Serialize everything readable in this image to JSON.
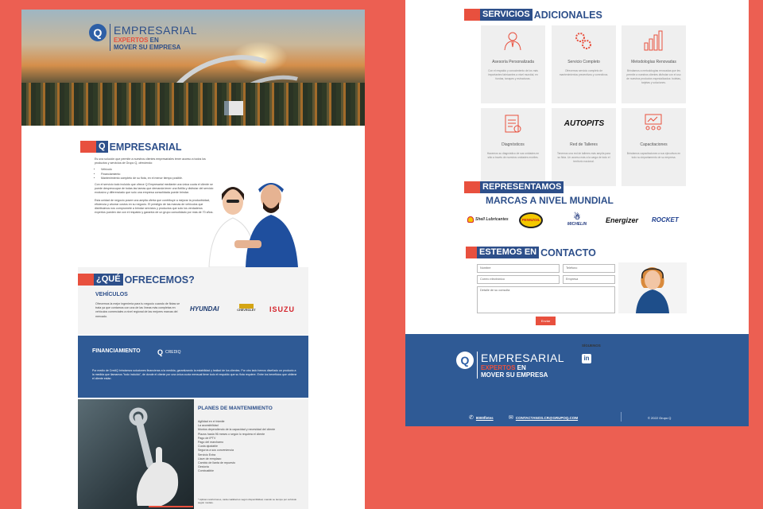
{
  "colors": {
    "accent": "#e8503e",
    "primary": "#2d4f8a",
    "background": "#ec5f52",
    "footer": "#2f5a95"
  },
  "hero": {
    "logo_title": "EMPRESARIAL",
    "logo_tag_red": "EXPERTOS",
    "logo_tag_white": " EN",
    "logo_tag_line2": "MOVER SU EMPRESA"
  },
  "intro": {
    "heading_q": "Q",
    "heading_rest": "EMPRESARIAL",
    "p1": "Es una solución que permite a nuestros clientes empresariales tener acceso a todos los productos y servicios de Grupo Q, ofreciendo:",
    "bullets": [
      "Vehículo",
      "Financiamiento",
      "Mantenimiento completo de su flota, en el menor tiempo posible."
    ],
    "p2": "Con el servicio todo incluido que ofrece Q Empresarial mediante una única cuota el cliente se puede despreocupar de todas las tareas que demanda tener una flotilla y disfrutar del servicio exclusivo y diferenciado que solo una empresa consolidada puede brindar.",
    "p3": "Esta unidad de negocio posee una amplia oferta que contribuye a mejorar la productividad, eficiencia y ahorrar costos en su negocio. El prestigio de las marcas de vehículos que distribuimos nos compromete a brindar servicios y productos que solo los verdaderos expertos pueden dar con el respaldo y garantía de un grupo consolidado por más de 70 años."
  },
  "offer": {
    "heading_block": "¿QUÉ",
    "heading_rest": "OFRECEMOS?",
    "vehicles_title": "VEHÍCULOS",
    "vehicles_text": "Ofrecemos la mejor ingeniería para tu negocio cuando de flotas se trata ya que contamos con una de las líneas más completas en vehículos comerciales a nivel regional de las mejores marcas del mercado.",
    "brands": [
      "HYUNDAI",
      "CHEVROLET",
      "ISUZU"
    ]
  },
  "financing": {
    "title": "FINANCIAMIENTO",
    "brand": "CREDIQ",
    "text": "Por medio de CrediQ brindamos soluciones financieras a la medida, garantizando la estabilidad y lealtad de los clientes. Por otro lado hemos diseñado un producto a la medida que llamamos \"todo incluido\", de donde el cliente por una única cuota mensual tiene todo el respaldo que su flota requiere. Entre los beneficios que obtiene el cliente están:"
  },
  "maintenance": {
    "title": "PLANES DE MANTENIMIENTO",
    "items": [
      "Agilidad en el trámite",
      "La accesibilidad",
      "Montos dependiendo de la capacidad y necesidad del cliente",
      "Plazos hasta 96 meses o según lo requiera el cliente",
      "Pago de IPTV",
      "Pago del marchamo",
      "Cuota ajustable",
      "Seguros a sus conveniencia",
      "Servicio Extra",
      "Llave de remplazo",
      "Cambio de llanta de repuesto",
      "Gestoría",
      "Combustible"
    ],
    "note": "* Aplican restricciones, cada cualidad es según disponibilidad, cuando se tiempo por vehículo según modelo."
  },
  "services": {
    "heading_block": "SERVICIOS",
    "heading_rest": "ADICIONALES",
    "tiles": [
      {
        "title": "Asesoría Personalizada",
        "desc": "Con el respaldo y conocimiento de los más importantes fabricantes a nivel mundial, en fundas, tanques y estructuras.",
        "icon": "advisor-icon"
      },
      {
        "title": "Servicio Completo",
        "desc": "Ofrecemos servicio completo de mantenimientos preventivos y correctivos.",
        "icon": "gears-icon"
      },
      {
        "title": "Metodologías Renovadas",
        "desc": "Brindamos a metodologías renovadas que les permite a nuestros clientes disfrutar con el uso de nuestros productos especializados: boletas, tarjetas y soluciones.",
        "icon": "bar-chart-icon"
      },
      {
        "title": "Diagnósticos",
        "desc": "Hacemos su diagnóstico de sus unidades en sitio a través de nuestros unidades móviles.",
        "icon": "clipboard-icon"
      },
      {
        "title": "Red de Talleres",
        "desc": "Tenemos una red de talleres más amplia para su flota. Un acceso más a la carga de todo el territorio nacional.",
        "icon": "autopits-logo"
      },
      {
        "title": "Capacitaciones",
        "desc": "Brindamos capacitaciones a sus ejecutivos en todo su departamento de su empresa.",
        "icon": "training-icon"
      }
    ],
    "autopits_text": "AUTOPITS"
  },
  "represent": {
    "heading_block": "REPRESENTAMOS",
    "subheading": "MARCAS A NIVEL MUNDIAL",
    "brands": [
      "Shell Lubricantes",
      "PENNZOIL",
      "MICHELIN",
      "Energizer",
      "ROCKET"
    ]
  },
  "contact": {
    "heading_block": "ESTEMOS EN",
    "heading_rest": "CONTACTO",
    "name_ph": "Nombre",
    "phone_ph": "Teléfono",
    "email_ph": "Correo electrónico",
    "company_ph": "Empresa",
    "detail_ph": "Detalle de su consulta",
    "submit": "Enviar"
  },
  "footer": {
    "logo_title": "EMPRESARIAL",
    "logo_tag_red": "EXPERTOS",
    "logo_tag_white": " EN",
    "logo_tag_line2": "MOVER SU EMPRESA",
    "follow": "SÍGUENOS",
    "phone": "8000fletes",
    "email": "CONTACTANOS.CR@GRUPOQ.COM",
    "copyright": "© 2022 Grupo Q"
  }
}
